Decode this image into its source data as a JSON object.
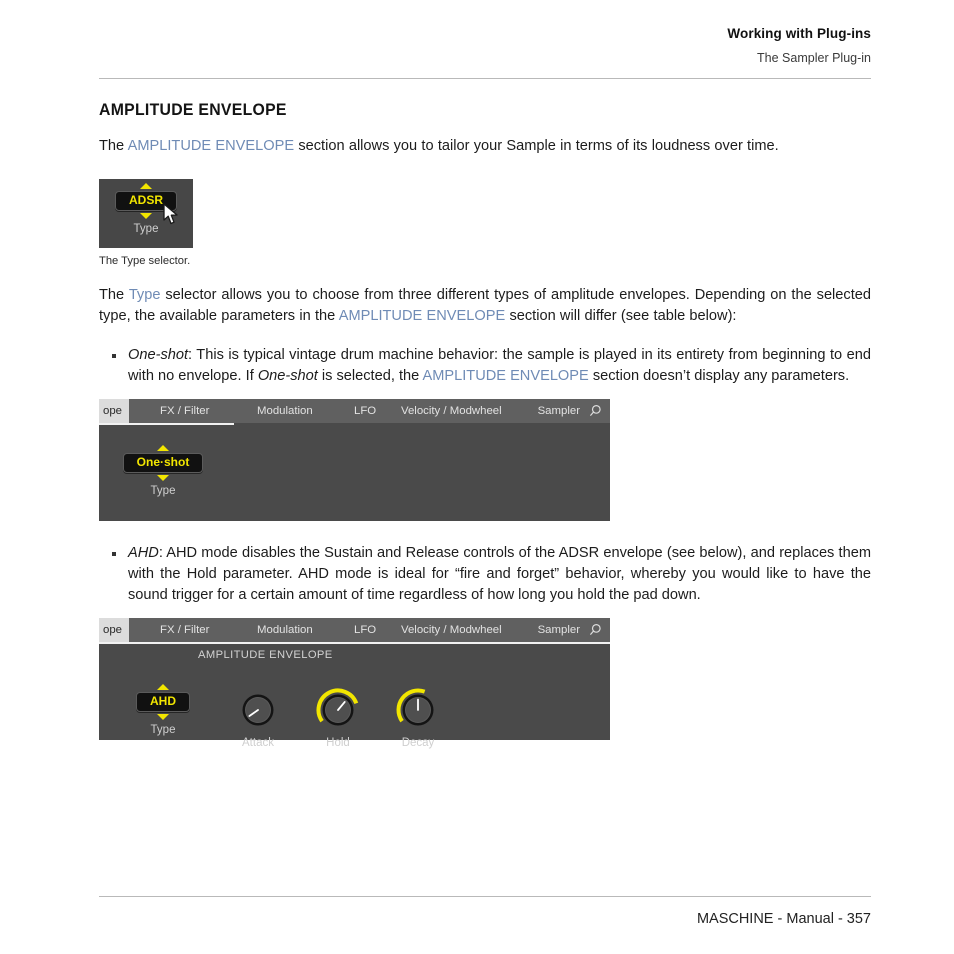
{
  "header": {
    "title": "Working with Plug-ins",
    "subtitle": "The Sampler Plug-in"
  },
  "section": {
    "heading": "AMPLITUDE ENVELOPE",
    "intro_pre": "The ",
    "intro_link": "AMPLITUDE ENVELOPE",
    "intro_post": " section allows you to tailor your Sample in terms of its loudness over time."
  },
  "figure1": {
    "caption": "The Type selector.",
    "selector_value": "ADSR",
    "param_label": "Type",
    "up_arrow_icon": "triangle-up-icon",
    "down_arrow_icon": "triangle-down-icon",
    "cursor_icon": "mouse-cursor-icon"
  },
  "paragraph2": {
    "pre": "The ",
    "link1": "Type",
    "mid": " selector allows you to choose from three different types of amplitude envelopes. Depending on the selected type, the available parameters in the ",
    "link2": "AMPLITUDE ENVELOPE",
    "post": " section will differ (see table below):"
  },
  "bullets": [
    {
      "term": "One-shot",
      "pre": ": This is typical vintage drum machine behavior: the sample is played in its entirety from beginning to end with no envelope. If ",
      "term2": "One-shot",
      "mid": " is selected, the ",
      "link": "AMPLITUDE ENVELOPE",
      "post": " section doesn’t display any parameters."
    },
    {
      "term": "AHD",
      "text": ": AHD mode disables the Sustain and Release controls of the ADSR envelope (see below), and replaces them with the Hold parameter. AHD mode is ideal for “fire and forget” behavior, whereby you would like to have the sound trigger for a certain amount of time regardless of how long you hold the pad down."
    }
  ],
  "plugin_tabs": {
    "active_tab": "ope",
    "tabs": [
      "FX / Filter",
      "Modulation",
      "LFO",
      "Velocity / Modwheel"
    ],
    "right_label": "Sampler",
    "search_icon": "magnifier-icon"
  },
  "figure2": {
    "selector_value": "One·shot",
    "param_label": "Type"
  },
  "figure3": {
    "section_name": "AMPLITUDE ENVELOPE",
    "selector_value": "AHD",
    "param_label": "Type",
    "knobs": [
      {
        "label": "Attack",
        "arc": 0,
        "pointer_deg": -125
      },
      {
        "label": "Hold",
        "arc": 78,
        "pointer_deg": 40
      },
      {
        "label": "Decay",
        "arc": 58,
        "pointer_deg": 0
      }
    ]
  },
  "footer": {
    "text": "MASCHINE - Manual - 357"
  },
  "colors": {
    "accent_yellow": "#f2e600",
    "panel_gray": "#4a4a4a",
    "tabbar_gray": "#606060",
    "link_blue": "#6f8bb5"
  }
}
